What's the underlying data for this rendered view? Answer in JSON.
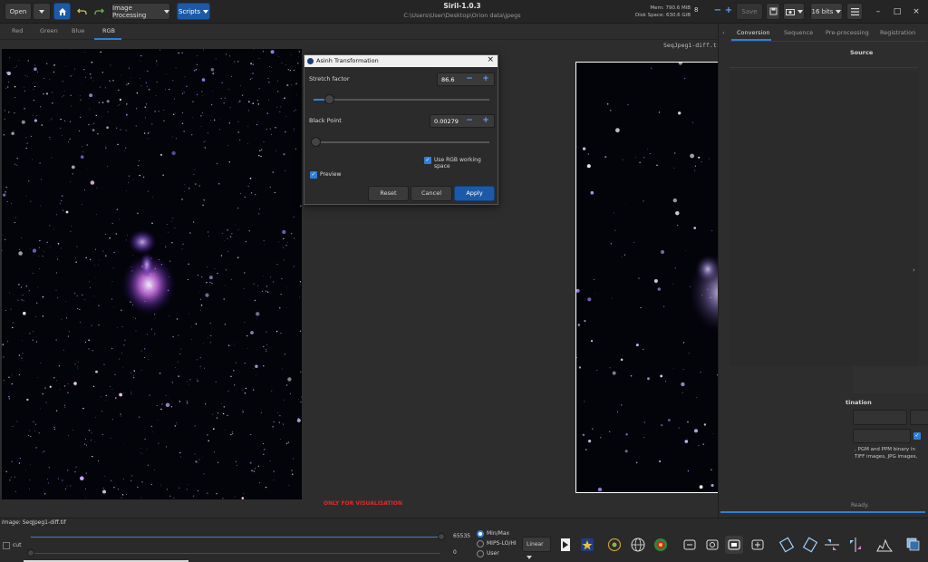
{
  "header": {
    "open_label": "Open",
    "image_processing_label": "Image Processing",
    "scripts_label": "Scripts",
    "app_title": "Siril-1.0.3",
    "path": "C:\\Users\\User\\Desktop\\Orion data\\jpegs",
    "mem": "Mem: 790.6 MiB",
    "disk": "Disk Space: 630.6 GiB",
    "thread_count": "8",
    "save_label": "Save",
    "bits_label": "16 bits",
    "minimize": "–",
    "maximize": "□",
    "close": "×"
  },
  "channel_tabs": [
    {
      "label": "Red"
    },
    {
      "label": "Green"
    },
    {
      "label": "Blue"
    },
    {
      "label": "RGB"
    }
  ],
  "image_filename": "SeqJpeg1-diff.tif",
  "vis_warning": "ONLY FOR VISUALISATION",
  "dialog": {
    "title": "Asinh Transformation",
    "stretch_label": "Stretch factor",
    "stretch_value": "86.6",
    "stretch_level": 0.09,
    "black_label": "Black Point",
    "black_value": "0.00279",
    "black_level": 0.01,
    "rgb_space_label": "Use RGB working space",
    "preview_label": "Preview",
    "reset_label": "Reset",
    "cancel_label": "Cancel",
    "apply_label": "Apply"
  },
  "right_panel": {
    "tabs": [
      {
        "label": "Conversion"
      },
      {
        "label": "Sequence"
      },
      {
        "label": "Pre-processing"
      },
      {
        "label": "Registration"
      }
    ],
    "source_label": "Source",
    "dest_label": "tination",
    "desc_line1": ", PGM and PPM binary in",
    "desc_line2": "TIFF images, JPG images,",
    "ready_label": "Ready."
  },
  "bottom": {
    "image_label_prefix": "Image:",
    "image_label_file": "SeqJpeg1-diff.tif",
    "high_value": "65535",
    "low_value": "0",
    "cut_label": "cut",
    "radio_minmax": "Min/Max",
    "radio_mips": "MIPS-LO/HI",
    "radio_user": "User",
    "scale_label": "Linear"
  },
  "colors": {
    "accent": "#1c5aa8",
    "accent_light": "#5aa3ff",
    "warning": "#e02a2a"
  }
}
